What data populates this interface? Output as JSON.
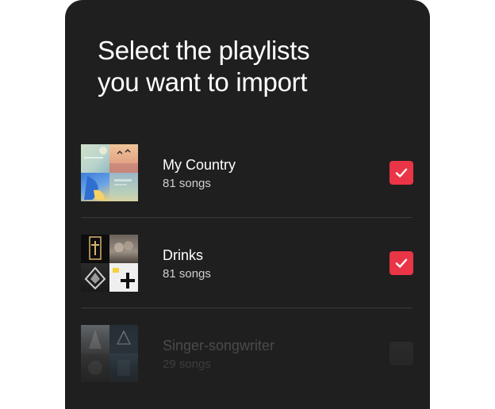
{
  "header": {
    "title_line1": "Select the playlists",
    "title_line2": "you want to import"
  },
  "accent_color": "#ea3546",
  "playlists": [
    {
      "name": "My Country",
      "count": "81 songs",
      "selected": true
    },
    {
      "name": "Drinks",
      "count": "81 songs",
      "selected": true
    },
    {
      "name": "Singer-songwriter",
      "count": "29 songs",
      "selected": false
    }
  ],
  "icons": {
    "checkbox_checked": "checkmark-icon"
  }
}
